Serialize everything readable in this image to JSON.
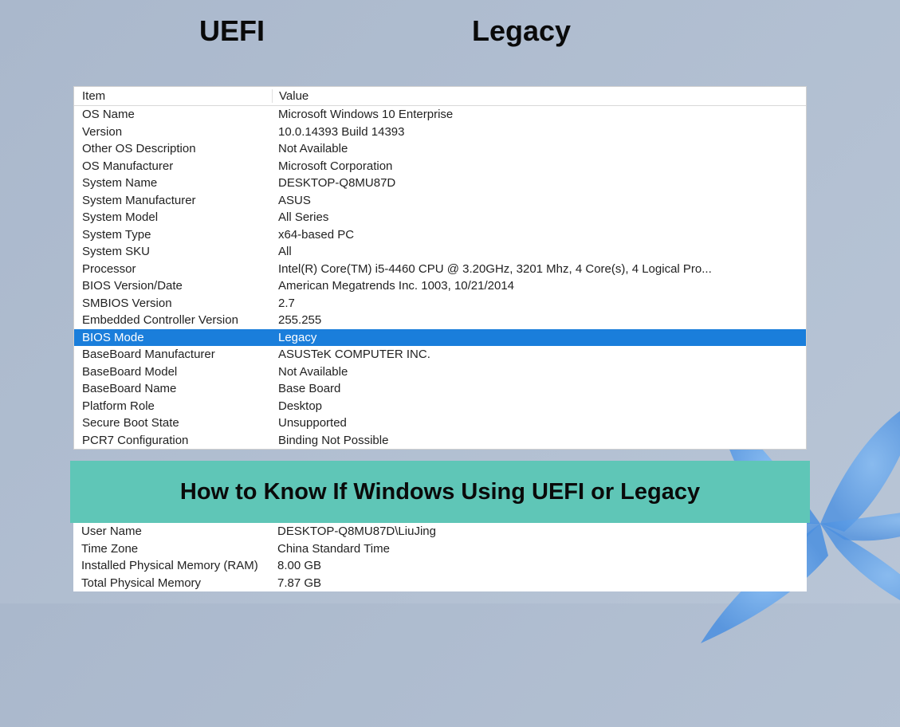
{
  "header": {
    "left": "UEFI",
    "right": "Legacy"
  },
  "columns": {
    "item": "Item",
    "value": "Value"
  },
  "rows": [
    {
      "item": "OS Name",
      "value": "Microsoft Windows 10 Enterprise",
      "selected": false
    },
    {
      "item": "Version",
      "value": "10.0.14393 Build 14393",
      "selected": false
    },
    {
      "item": "Other OS Description",
      "value": "Not Available",
      "selected": false
    },
    {
      "item": "OS Manufacturer",
      "value": "Microsoft Corporation",
      "selected": false
    },
    {
      "item": "System Name",
      "value": "DESKTOP-Q8MU87D",
      "selected": false
    },
    {
      "item": "System Manufacturer",
      "value": "ASUS",
      "selected": false
    },
    {
      "item": "System Model",
      "value": "All Series",
      "selected": false
    },
    {
      "item": "System Type",
      "value": "x64-based PC",
      "selected": false
    },
    {
      "item": "System SKU",
      "value": "All",
      "selected": false
    },
    {
      "item": "Processor",
      "value": "Intel(R) Core(TM) i5-4460  CPU @ 3.20GHz, 3201 Mhz, 4 Core(s), 4 Logical Pro...",
      "selected": false
    },
    {
      "item": "BIOS Version/Date",
      "value": "American Megatrends Inc. 1003, 10/21/2014",
      "selected": false
    },
    {
      "item": "SMBIOS Version",
      "value": "2.7",
      "selected": false
    },
    {
      "item": "Embedded Controller Version",
      "value": "255.255",
      "selected": false
    },
    {
      "item": "BIOS Mode",
      "value": "Legacy",
      "selected": true
    },
    {
      "item": "BaseBoard Manufacturer",
      "value": "ASUSTeK COMPUTER INC.",
      "selected": false
    },
    {
      "item": "BaseBoard Model",
      "value": "Not Available",
      "selected": false
    },
    {
      "item": "BaseBoard Name",
      "value": "Base Board",
      "selected": false
    },
    {
      "item": "Platform Role",
      "value": "Desktop",
      "selected": false
    },
    {
      "item": "Secure Boot State",
      "value": "Unsupported",
      "selected": false
    },
    {
      "item": "PCR7 Configuration",
      "value": "Binding Not Possible",
      "selected": false
    }
  ],
  "lower_rows": [
    {
      "item": "User Name",
      "value": "DESKTOP-Q8MU87D\\LiuJing"
    },
    {
      "item": "Time Zone",
      "value": "China Standard Time"
    },
    {
      "item": "Installed Physical Memory (RAM)",
      "value": "8.00 GB"
    },
    {
      "item": "Total Physical Memory",
      "value": "7.87 GB"
    }
  ],
  "banner": "How to Know If Windows Using UEFI or Legacy"
}
